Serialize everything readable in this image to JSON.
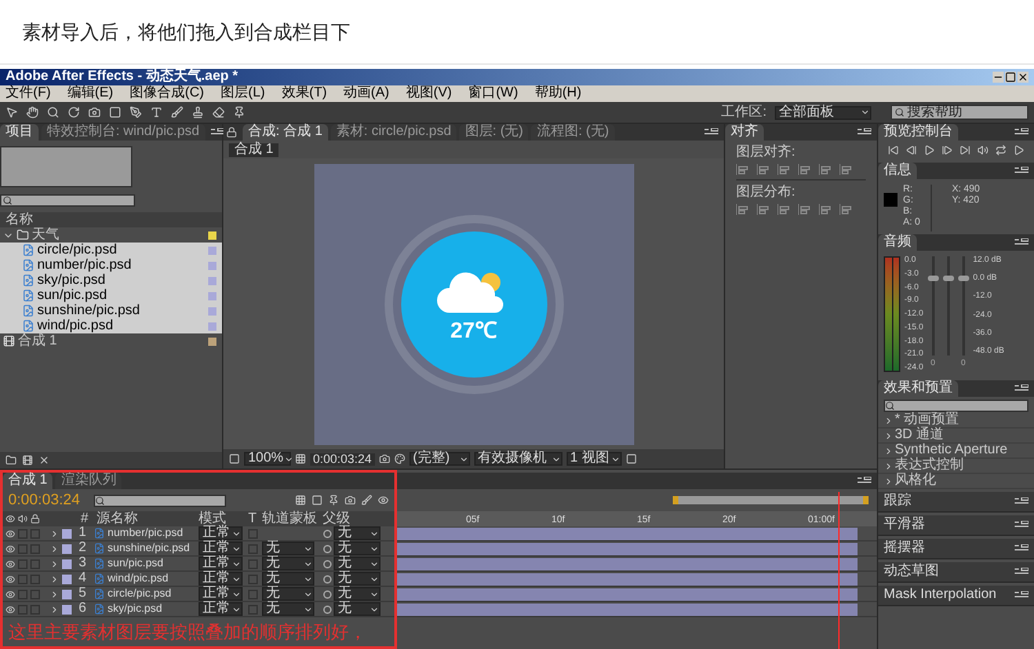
{
  "heading": "素材导入后，将他们拖入到合成栏目下",
  "window": {
    "title": "Adobe After Effects - 动态天气.aep *"
  },
  "menu": [
    "文件(F)",
    "编辑(E)",
    "图像合成(C)",
    "图层(L)",
    "效果(T)",
    "动画(A)",
    "视图(V)",
    "窗口(W)",
    "帮助(H)"
  ],
  "toolbar": {
    "workspace_label": "工作区:",
    "workspace": "全部面板",
    "search": {
      "placeholder": "搜索帮助"
    }
  },
  "project": {
    "tabs": [
      {
        "label": "项目",
        "selected": true
      },
      {
        "label": "特效控制台: wind/pic.psd",
        "selected": false
      }
    ],
    "column": "名称",
    "items": [
      {
        "name": "天气",
        "kind": "folder",
        "expanded": true,
        "selected": false,
        "color": "#e8d44a",
        "children": [
          {
            "name": "circle/pic.psd",
            "kind": "footage",
            "selected": true,
            "color": "#a9a9d9"
          },
          {
            "name": "number/pic.psd",
            "kind": "footage",
            "selected": true,
            "color": "#a9a9d9"
          },
          {
            "name": "sky/pic.psd",
            "kind": "footage",
            "selected": true,
            "color": "#a9a9d9"
          },
          {
            "name": "sun/pic.psd",
            "kind": "footage",
            "selected": true,
            "color": "#a9a9d9"
          },
          {
            "name": "sunshine/pic.psd",
            "kind": "footage",
            "selected": true,
            "color": "#a9a9d9"
          },
          {
            "name": "wind/pic.psd",
            "kind": "footage",
            "selected": true,
            "color": "#a9a9d9"
          }
        ]
      },
      {
        "name": "合成 1",
        "kind": "composition",
        "selected": false,
        "color": "#bca27a"
      }
    ]
  },
  "viewer": {
    "tabs": [
      {
        "label": "合成: 合成 1",
        "selected": true
      },
      {
        "label": "素材: circle/pic.psd",
        "selected": false
      },
      {
        "label": "图层: (无)",
        "selected": false
      },
      {
        "label": "流程图: (无)",
        "selected": false
      }
    ],
    "comp_tab": "合成 1",
    "temperature": "27℃",
    "zoom": "100%",
    "time": "0:00:03:24",
    "resolution": "(完整)",
    "camera": "有效摄像机",
    "views": "1 视图"
  },
  "align": {
    "title": "对齐",
    "align_label": "图层对齐:",
    "distribute_label": "图层分布:"
  },
  "preview": {
    "title": "预览控制台"
  },
  "info": {
    "title": "信息",
    "r": "R:",
    "g": "G:",
    "b": "B:",
    "a": "A: 0",
    "x": "X: 490",
    "y": "Y: 420"
  },
  "audio": {
    "title": "音频",
    "left_scale": [
      "0.0",
      "-3.0",
      "-6.0",
      "-9.0",
      "-12.0",
      "-15.0",
      "-18.0",
      "-21.0",
      "-24.0"
    ],
    "right_scale": [
      "12.0 dB",
      "0.0 dB",
      "-12.0",
      "-24.0",
      "-36.0",
      "-48.0 dB"
    ],
    "channels": [
      {
        "level": 0.78,
        "reading": "0"
      },
      {
        "level": 0.78
      },
      {
        "level": 0.78,
        "reading": "0"
      }
    ]
  },
  "effects": {
    "title": "效果和预置",
    "items": [
      {
        "label": "* 动画预置",
        "expanded": false
      },
      {
        "label": "3D 通道",
        "expanded": false
      },
      {
        "label": "Synthetic Aperture",
        "expanded": false
      },
      {
        "label": "表达式控制",
        "expanded": false
      },
      {
        "label": "风格化",
        "expanded": false
      }
    ]
  },
  "side_panels": [
    "跟踪",
    "平滑器",
    "摇摆器",
    "动态草图",
    "Mask Interpolation"
  ],
  "timeline": {
    "tabs": [
      {
        "label": "合成 1",
        "selected": true
      },
      {
        "label": "渲染队列",
        "selected": false
      }
    ],
    "time": "0:00:03:24",
    "columns": [
      "#",
      "源名称",
      "模式",
      "T",
      "轨道蒙板",
      "父级"
    ],
    "ruler": [
      "05f",
      "10f",
      "15f",
      "20f",
      "01:00f"
    ],
    "layers": [
      {
        "index": "1",
        "name": "number/pic.psd",
        "mode": "正常",
        "preserve_transparency": false,
        "parent": "无"
      },
      {
        "index": "2",
        "name": "sunshine/pic.psd",
        "mode": "正常",
        "preserve_transparency": false,
        "track_matte": "无",
        "parent": "无"
      },
      {
        "index": "3",
        "name": "sun/pic.psd",
        "mode": "正常",
        "preserve_transparency": false,
        "track_matte": "无",
        "parent": "无"
      },
      {
        "index": "4",
        "name": "wind/pic.psd",
        "mode": "正常",
        "preserve_transparency": false,
        "track_matte": "无",
        "parent": "无"
      },
      {
        "index": "5",
        "name": "circle/pic.psd",
        "mode": "正常",
        "preserve_transparency": false,
        "track_matte": "无",
        "parent": "无"
      },
      {
        "index": "6",
        "name": "sky/pic.psd",
        "mode": "正常",
        "preserve_transparency": false,
        "track_matte": "无",
        "parent": "无"
      }
    ]
  },
  "annotation": "这里主要素材图层要按照叠加的顺序排列好，"
}
